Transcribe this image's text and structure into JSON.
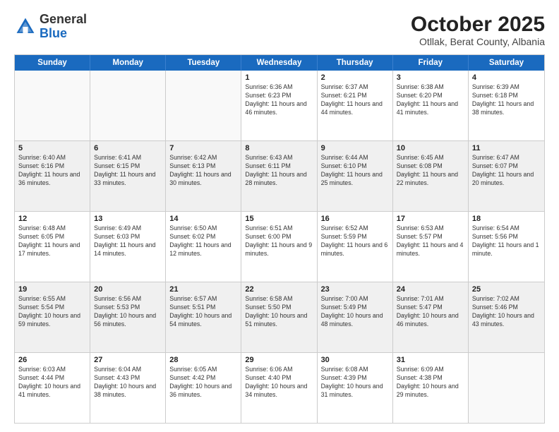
{
  "header": {
    "logo_general": "General",
    "logo_blue": "Blue",
    "month_title": "October 2025",
    "location": "Otllak, Berat County, Albania"
  },
  "days_of_week": [
    "Sunday",
    "Monday",
    "Tuesday",
    "Wednesday",
    "Thursday",
    "Friday",
    "Saturday"
  ],
  "rows": [
    [
      {
        "day": "",
        "info": "",
        "empty": true
      },
      {
        "day": "",
        "info": "",
        "empty": true
      },
      {
        "day": "",
        "info": "",
        "empty": true
      },
      {
        "day": "1",
        "info": "Sunrise: 6:36 AM\nSunset: 6:23 PM\nDaylight: 11 hours and 46 minutes."
      },
      {
        "day": "2",
        "info": "Sunrise: 6:37 AM\nSunset: 6:21 PM\nDaylight: 11 hours and 44 minutes."
      },
      {
        "day": "3",
        "info": "Sunrise: 6:38 AM\nSunset: 6:20 PM\nDaylight: 11 hours and 41 minutes."
      },
      {
        "day": "4",
        "info": "Sunrise: 6:39 AM\nSunset: 6:18 PM\nDaylight: 11 hours and 38 minutes."
      }
    ],
    [
      {
        "day": "5",
        "info": "Sunrise: 6:40 AM\nSunset: 6:16 PM\nDaylight: 11 hours and 36 minutes.",
        "shaded": true
      },
      {
        "day": "6",
        "info": "Sunrise: 6:41 AM\nSunset: 6:15 PM\nDaylight: 11 hours and 33 minutes.",
        "shaded": true
      },
      {
        "day": "7",
        "info": "Sunrise: 6:42 AM\nSunset: 6:13 PM\nDaylight: 11 hours and 30 minutes.",
        "shaded": true
      },
      {
        "day": "8",
        "info": "Sunrise: 6:43 AM\nSunset: 6:11 PM\nDaylight: 11 hours and 28 minutes.",
        "shaded": true
      },
      {
        "day": "9",
        "info": "Sunrise: 6:44 AM\nSunset: 6:10 PM\nDaylight: 11 hours and 25 minutes.",
        "shaded": true
      },
      {
        "day": "10",
        "info": "Sunrise: 6:45 AM\nSunset: 6:08 PM\nDaylight: 11 hours and 22 minutes.",
        "shaded": true
      },
      {
        "day": "11",
        "info": "Sunrise: 6:47 AM\nSunset: 6:07 PM\nDaylight: 11 hours and 20 minutes.",
        "shaded": true
      }
    ],
    [
      {
        "day": "12",
        "info": "Sunrise: 6:48 AM\nSunset: 6:05 PM\nDaylight: 11 hours and 17 minutes."
      },
      {
        "day": "13",
        "info": "Sunrise: 6:49 AM\nSunset: 6:03 PM\nDaylight: 11 hours and 14 minutes."
      },
      {
        "day": "14",
        "info": "Sunrise: 6:50 AM\nSunset: 6:02 PM\nDaylight: 11 hours and 12 minutes."
      },
      {
        "day": "15",
        "info": "Sunrise: 6:51 AM\nSunset: 6:00 PM\nDaylight: 11 hours and 9 minutes."
      },
      {
        "day": "16",
        "info": "Sunrise: 6:52 AM\nSunset: 5:59 PM\nDaylight: 11 hours and 6 minutes."
      },
      {
        "day": "17",
        "info": "Sunrise: 6:53 AM\nSunset: 5:57 PM\nDaylight: 11 hours and 4 minutes."
      },
      {
        "day": "18",
        "info": "Sunrise: 6:54 AM\nSunset: 5:56 PM\nDaylight: 11 hours and 1 minute."
      }
    ],
    [
      {
        "day": "19",
        "info": "Sunrise: 6:55 AM\nSunset: 5:54 PM\nDaylight: 10 hours and 59 minutes.",
        "shaded": true
      },
      {
        "day": "20",
        "info": "Sunrise: 6:56 AM\nSunset: 5:53 PM\nDaylight: 10 hours and 56 minutes.",
        "shaded": true
      },
      {
        "day": "21",
        "info": "Sunrise: 6:57 AM\nSunset: 5:51 PM\nDaylight: 10 hours and 54 minutes.",
        "shaded": true
      },
      {
        "day": "22",
        "info": "Sunrise: 6:58 AM\nSunset: 5:50 PM\nDaylight: 10 hours and 51 minutes.",
        "shaded": true
      },
      {
        "day": "23",
        "info": "Sunrise: 7:00 AM\nSunset: 5:49 PM\nDaylight: 10 hours and 48 minutes.",
        "shaded": true
      },
      {
        "day": "24",
        "info": "Sunrise: 7:01 AM\nSunset: 5:47 PM\nDaylight: 10 hours and 46 minutes.",
        "shaded": true
      },
      {
        "day": "25",
        "info": "Sunrise: 7:02 AM\nSunset: 5:46 PM\nDaylight: 10 hours and 43 minutes.",
        "shaded": true
      }
    ],
    [
      {
        "day": "26",
        "info": "Sunrise: 6:03 AM\nSunset: 4:44 PM\nDaylight: 10 hours and 41 minutes."
      },
      {
        "day": "27",
        "info": "Sunrise: 6:04 AM\nSunset: 4:43 PM\nDaylight: 10 hours and 38 minutes."
      },
      {
        "day": "28",
        "info": "Sunrise: 6:05 AM\nSunset: 4:42 PM\nDaylight: 10 hours and 36 minutes."
      },
      {
        "day": "29",
        "info": "Sunrise: 6:06 AM\nSunset: 4:40 PM\nDaylight: 10 hours and 34 minutes."
      },
      {
        "day": "30",
        "info": "Sunrise: 6:08 AM\nSunset: 4:39 PM\nDaylight: 10 hours and 31 minutes."
      },
      {
        "day": "31",
        "info": "Sunrise: 6:09 AM\nSunset: 4:38 PM\nDaylight: 10 hours and 29 minutes."
      },
      {
        "day": "",
        "info": "",
        "empty": true
      }
    ]
  ]
}
